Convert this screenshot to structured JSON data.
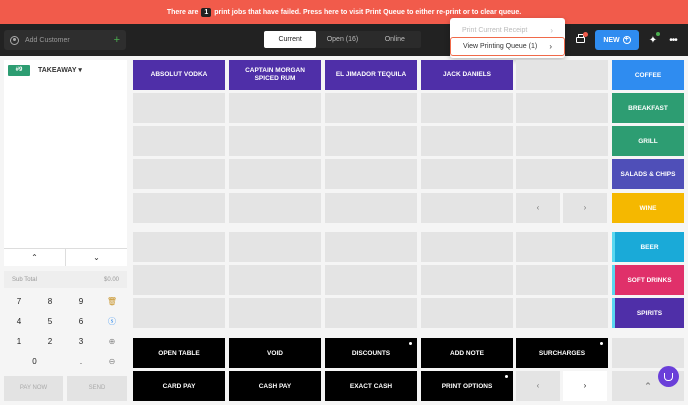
{
  "banner": {
    "prefix": "There are",
    "count": "1",
    "message": "print jobs that have failed. Press here to visit Print Queue to either re-print or to clear queue."
  },
  "topbar": {
    "customer_placeholder": "Add Customer",
    "tabs": [
      {
        "label": "Current",
        "active": true
      },
      {
        "label": "Open (16)",
        "active": false
      },
      {
        "label": "Online",
        "active": false
      }
    ],
    "new_label": "NEW"
  },
  "dropdown": {
    "items": [
      {
        "label": "Print Current Receipt",
        "disabled": true
      },
      {
        "label": "View Printing Queue (1)",
        "disabled": false
      }
    ]
  },
  "order": {
    "number": "#9",
    "type": "TAKEAWAY",
    "subtotal_label": "Sub Total",
    "subtotal_value": "$0.00"
  },
  "keypad": {
    "keys": [
      "7",
      "8",
      "9",
      "4",
      "5",
      "6",
      "1",
      "2",
      "3",
      "0",
      "."
    ],
    "pay_now": "PAY NOW",
    "send": "SEND"
  },
  "products": [
    {
      "label": "ABSOLUT VODKA"
    },
    {
      "label": "CAPTAIN MORGAN SPICED RUM"
    },
    {
      "label": "EL JIMADOR TEQUILA"
    },
    {
      "label": "JACK DANIELS"
    }
  ],
  "actions": [
    {
      "label": "OPEN TABLE",
      "dot": false
    },
    {
      "label": "VOID",
      "dot": false
    },
    {
      "label": "DISCOUNTS",
      "dot": true
    },
    {
      "label": "ADD NOTE",
      "dot": false
    },
    {
      "label": "SURCHARGES",
      "dot": true
    },
    {
      "label": "CARD PAY",
      "dot": false
    },
    {
      "label": "CASH PAY",
      "dot": false
    },
    {
      "label": "EXACT CASH",
      "dot": false
    },
    {
      "label": "PRINT OPTIONS",
      "dot": true
    }
  ],
  "categories": [
    {
      "label": "COFFEE",
      "color": "#2f8cf0"
    },
    {
      "label": "BREAKFAST",
      "color": "#2d9d72"
    },
    {
      "label": "GRILL",
      "color": "#2d9d72"
    },
    {
      "label": "SALADS & CHIPS",
      "color": "#4f4fb8"
    },
    {
      "label": "WINE",
      "color": "#f5b800"
    },
    {
      "label": "BEER",
      "color": "#1aaad8"
    },
    {
      "label": "SOFT DRINKS",
      "color": "#e0306a"
    },
    {
      "label": "SPIRITS",
      "color": "#4f2fa8"
    }
  ]
}
